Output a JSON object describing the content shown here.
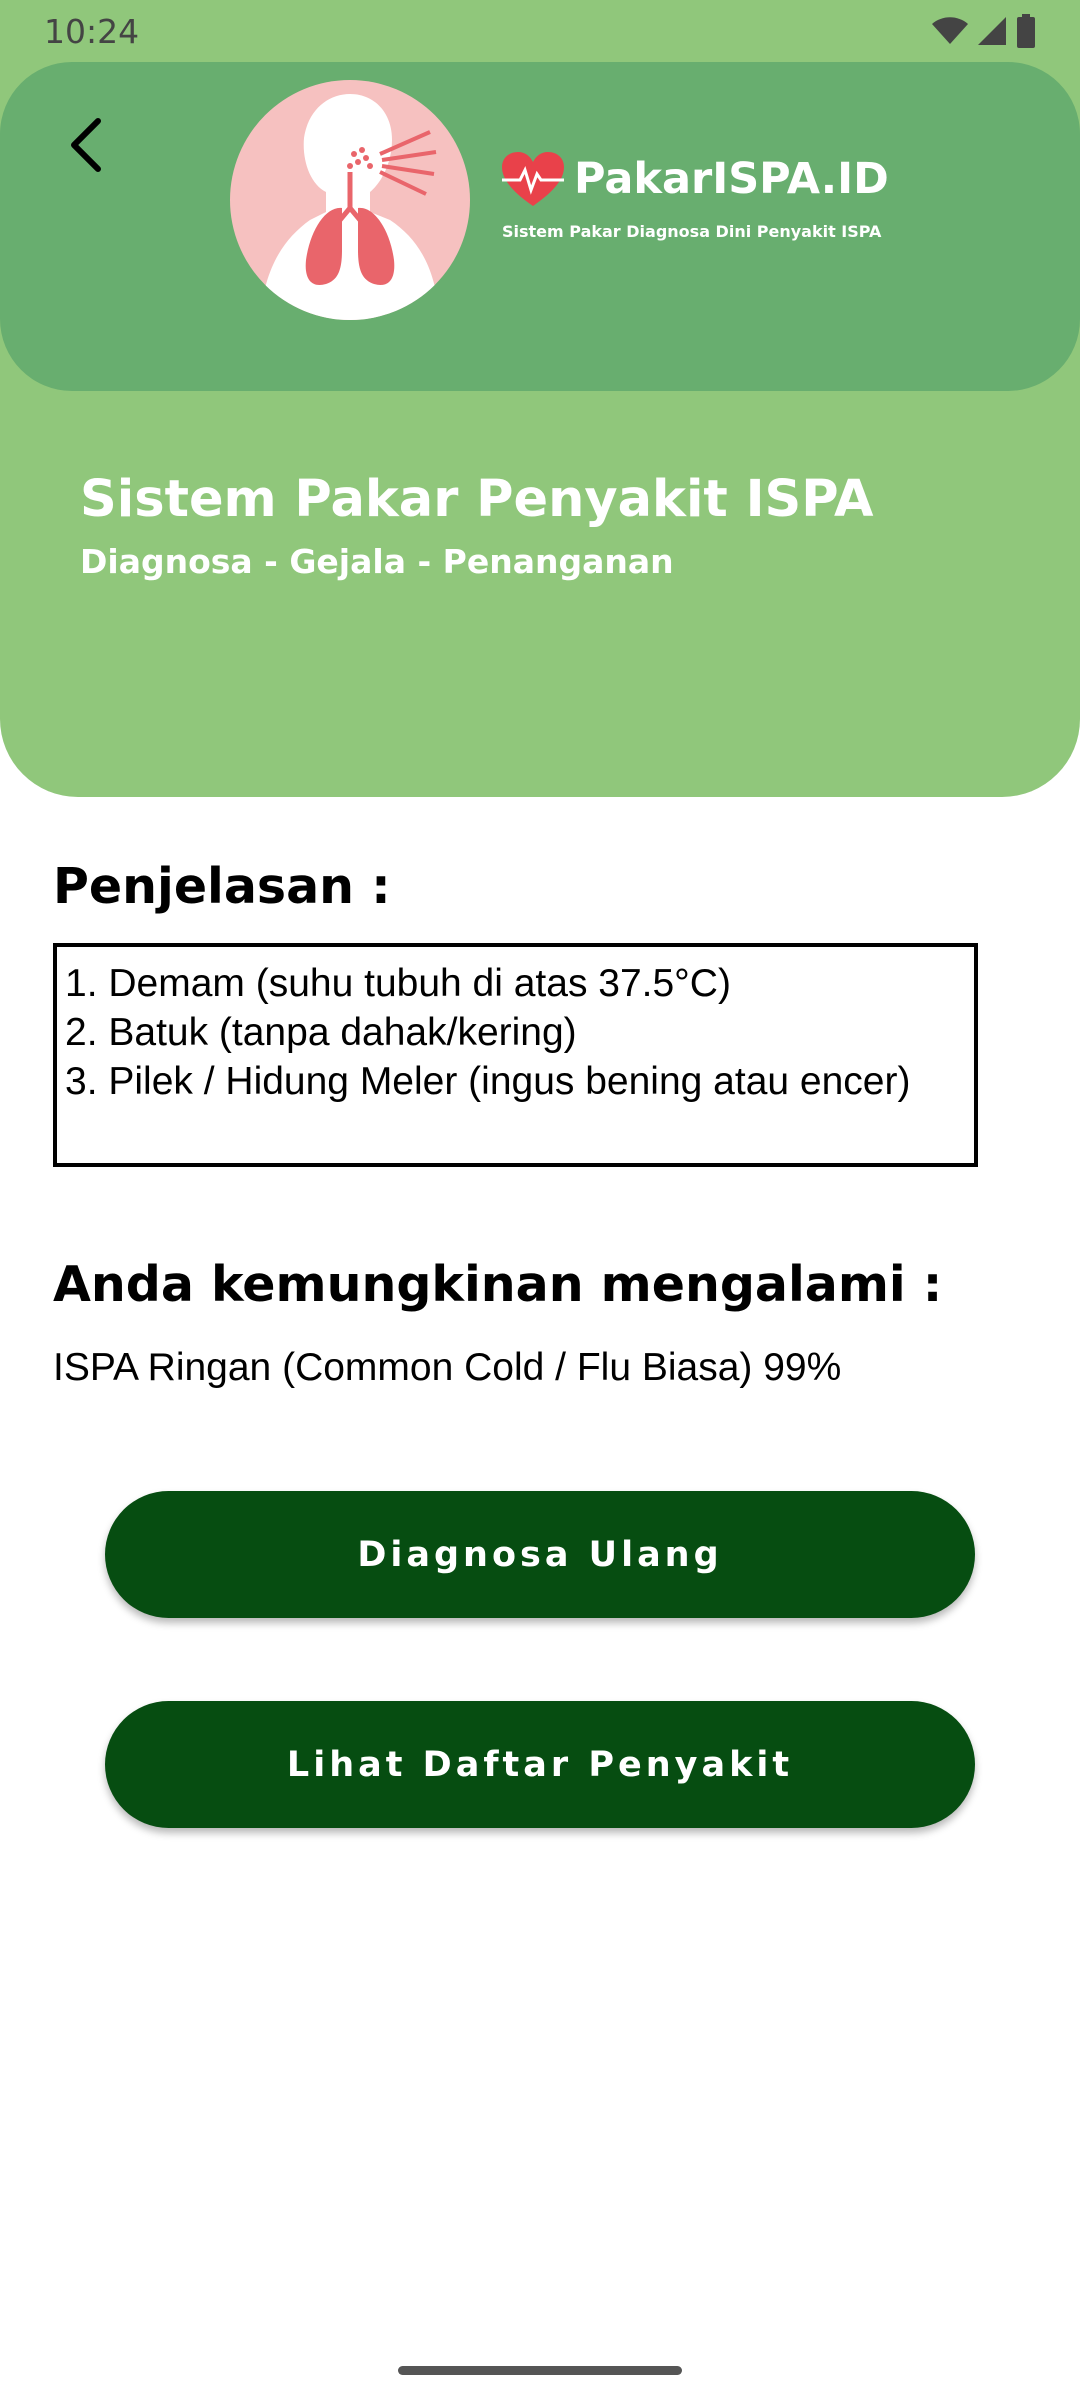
{
  "status_bar": {
    "time": "10:24"
  },
  "header": {
    "brand_name": "PakarISPA.ID",
    "brand_tagline": "Sistem Pakar Diagnosa Dini Penyakit ISPA",
    "title": "Sistem Pakar Penyakit ISPA",
    "subtitle": "Diagnosa - Gejala - Penanganan"
  },
  "explanation": {
    "heading": "Penjelasan :",
    "items": [
      "1. Demam (suhu tubuh di atas 37.5°C)",
      "2. Batuk (tanpa dahak/kering)",
      "3. Pilek / Hidung Meler (ingus bening atau encer)"
    ]
  },
  "result": {
    "heading": "Anda kemungkinan mengalami :",
    "text": "ISPA Ringan (Common Cold / Flu Biasa) 99%"
  },
  "buttons": {
    "rediagnose": "Diagnosa Ulang",
    "disease_list": "Lihat Daftar Penyakit"
  },
  "colors": {
    "hero_light": "#90c77b",
    "hero_dark": "#68ae6f",
    "button": "#064d11",
    "logo_bg": "#f6c1c0"
  },
  "icons": [
    "wifi-icon",
    "signal-icon",
    "battery-icon",
    "back-arrow-icon",
    "lungs-logo-icon",
    "heart-pulse-icon"
  ]
}
